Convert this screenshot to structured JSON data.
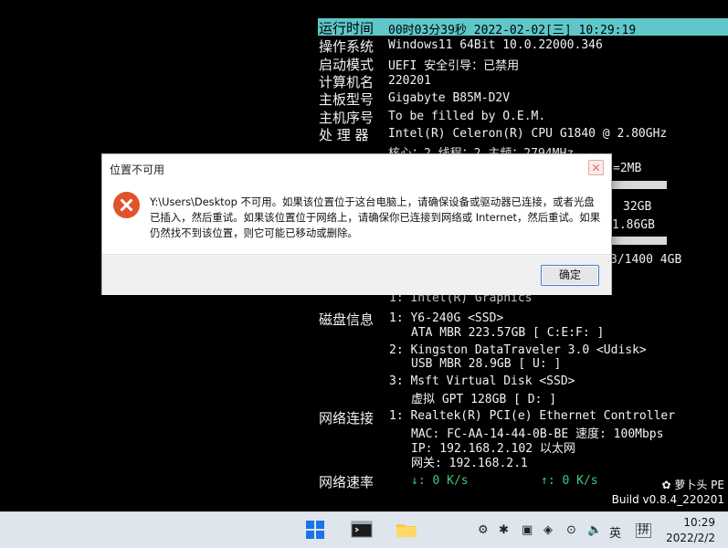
{
  "sysinfo": {
    "uptime_label": "运行时间",
    "uptime_value": "00时03分39秒 2022-02-02[三] 10:29:19",
    "os_label": "操作系统",
    "os_value": "Windows11 64Bit  10.0.22000.346",
    "boot_label": "启动模式",
    "boot_value": "UEFI  安全引导：已禁用",
    "pcname_label": "计算机名",
    "pcname_value": "220201",
    "board_label": "主板型号",
    "board_value": "Gigabyte B85M-D2V",
    "serial_label": "主机序号",
    "serial_value": "To be filled by O.E.M.",
    "cpu_label": "处 理 器",
    "cpu_value": "Intel(R) Celeron(R) CPU G1840 @ 2.80GHz",
    "cpu_detail": "核心：2  线程：2       主频：2794MHz",
    "cache_partial": "=2MB",
    "mem_total_partial": "32GB",
    "mem_used_partial": "1.86GB",
    "mem_slot_partial": "3/1400 4GB",
    "gpu_partial": "1: Intel(R) Graphics",
    "disk_label": "磁盘信息",
    "disks": [
      {
        "line1": "1: Y6-240G <SSD>",
        "line2": "ATA MBR 223.57GB [ C:E:F: ]"
      },
      {
        "line1": "2: Kingston DataTraveler 3.0 <Udisk>",
        "line2": "USB MBR 28.9GB [ U: ]"
      },
      {
        "line1": "3: Msft Virtual Disk <SSD>",
        "line2": "虚拟 GPT 128GB [ D: ]"
      }
    ],
    "net_label": "网络连接",
    "net_line1": "1: Realtek(R) PCI(e) Ethernet Controller",
    "net_line2": "MAC: FC-AA-14-44-0B-BE 速度: 100Mbps",
    "net_line3": "IP: 192.168.2.102 以太网",
    "net_line4": "网关: 192.168.2.1",
    "speed_label": "网络速率",
    "down_label": "↓: 0 K/s",
    "up_label": "↑: 0 K/s",
    "colors": {
      "highlight": "#5fc7c9",
      "arrow": "#3ec97e"
    }
  },
  "dialog": {
    "title": "位置不可用",
    "message": "Y:\\Users\\Desktop 不可用。如果该位置位于这台电脑上，请确保设备或驱动器已连接，或者光盘已插入，然后重试。如果该位置位于网络上，请确保你已连接到网络或 Internet，然后重试。如果仍然找不到该位置，则它可能已移动或删除。",
    "ok_label": "确定"
  },
  "branding": {
    "name": "萝卜头 PE",
    "build": "Build v0.8.4_220201"
  },
  "taskbar": {
    "ime_lang": "英",
    "ime_mode": "拼",
    "time": "10:29",
    "date": "2022/2/2"
  }
}
